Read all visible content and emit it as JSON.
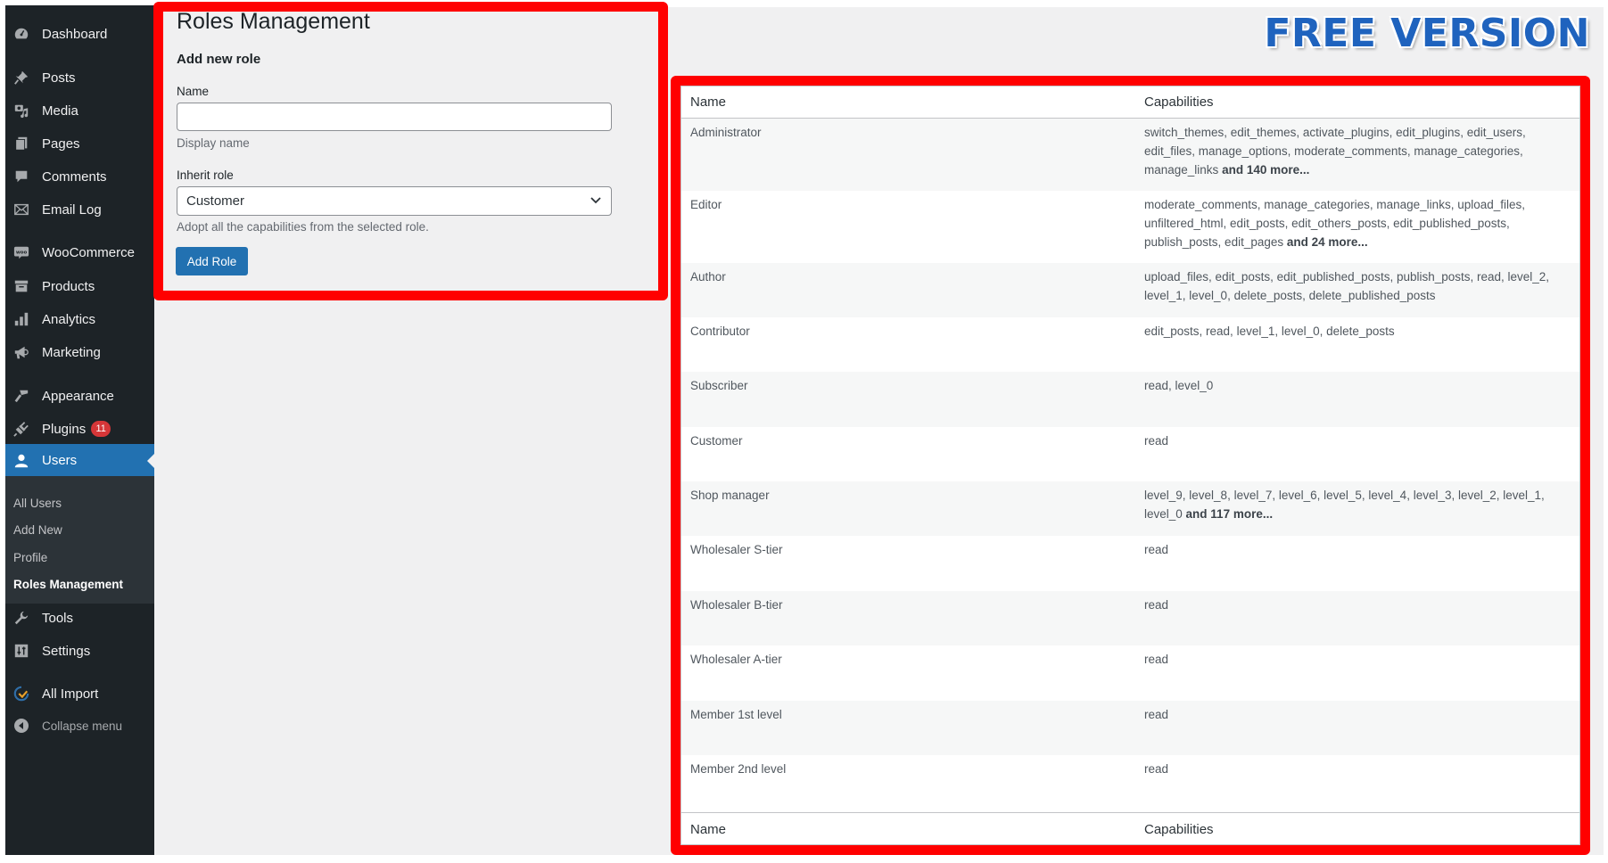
{
  "sidebar": {
    "items": [
      {
        "label": "Dashboard",
        "icon": "dashboard-icon"
      },
      {
        "label": "Posts",
        "icon": "pin-icon"
      },
      {
        "label": "Media",
        "icon": "media-icon"
      },
      {
        "label": "Pages",
        "icon": "pages-icon"
      },
      {
        "label": "Comments",
        "icon": "comment-icon"
      },
      {
        "label": "Email Log",
        "icon": "envelope-icon"
      },
      {
        "label": "WooCommerce",
        "icon": "woocommerce-icon"
      },
      {
        "label": "Products",
        "icon": "archive-icon"
      },
      {
        "label": "Analytics",
        "icon": "bar-chart-icon"
      },
      {
        "label": "Marketing",
        "icon": "megaphone-icon"
      },
      {
        "label": "Appearance",
        "icon": "paintbrush-icon"
      },
      {
        "label": "Plugins",
        "icon": "plug-icon",
        "badge": "11"
      },
      {
        "label": "Users",
        "icon": "user-icon",
        "current": true
      },
      {
        "label": "Tools",
        "icon": "wrench-icon"
      },
      {
        "label": "Settings",
        "icon": "sliders-icon"
      },
      {
        "label": "All Import",
        "icon": "import-icon"
      }
    ],
    "submenu": [
      {
        "label": "All Users"
      },
      {
        "label": "Add New"
      },
      {
        "label": "Profile"
      },
      {
        "label": "Roles Management",
        "current": true
      }
    ],
    "collapse_label": "Collapse menu"
  },
  "page": {
    "title": "Roles Management",
    "banner": "FREE VERSION",
    "accent": "#2271b1",
    "highlight": "#ff0000"
  },
  "form": {
    "heading": "Add new role",
    "name_label": "Name",
    "name_value": "",
    "name_desc": "Display name",
    "inherit_label": "Inherit role",
    "inherit_value": "Customer",
    "inherit_desc": "Adopt all the capabilities from the selected role.",
    "submit_label": "Add Role"
  },
  "table": {
    "columns": [
      "Name",
      "Capabilities"
    ],
    "rows": [
      {
        "name": "Administrator",
        "caps": "switch_themes, edit_themes, activate_plugins, edit_plugins, edit_users, edit_files, manage_options, moderate_comments, manage_categories, manage_links",
        "more": "and 140 more..."
      },
      {
        "name": "Editor",
        "caps": "moderate_comments, manage_categories, manage_links, upload_files, unfiltered_html, edit_posts, edit_others_posts, edit_published_posts, publish_posts, edit_pages",
        "more": "and 24 more..."
      },
      {
        "name": "Author",
        "caps": "upload_files, edit_posts, edit_published_posts, publish_posts, read, level_2, level_1, level_0, delete_posts, delete_published_posts",
        "more": ""
      },
      {
        "name": "Contributor",
        "caps": "edit_posts, read, level_1, level_0, delete_posts",
        "more": ""
      },
      {
        "name": "Subscriber",
        "caps": "read, level_0",
        "more": ""
      },
      {
        "name": "Customer",
        "caps": "read",
        "more": ""
      },
      {
        "name": "Shop manager",
        "caps": "level_9, level_8, level_7, level_6, level_5, level_4, level_3, level_2, level_1, level_0",
        "more": "and 117 more..."
      },
      {
        "name": "Wholesaler S-tier",
        "caps": "read",
        "more": ""
      },
      {
        "name": "Wholesaler B-tier",
        "caps": "read",
        "more": ""
      },
      {
        "name": "Wholesaler A-tier",
        "caps": "read",
        "more": ""
      },
      {
        "name": "Member 1st level",
        "caps": "read",
        "more": ""
      },
      {
        "name": "Member 2nd level",
        "caps": "read",
        "more": ""
      }
    ]
  }
}
